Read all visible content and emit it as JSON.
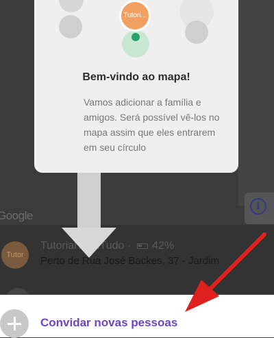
{
  "map": {
    "google_logo": "Google",
    "info_button_glyph": "i"
  },
  "modal": {
    "pin_tutorial_label": "Tutori...",
    "title": "Bem-vindo ao mapa!",
    "body_lines": [
      "Vamos adicionar a família e",
      "amigos. Será possível vê-los no",
      "mapa assim que eles entrarem",
      "em seu círculo"
    ]
  },
  "member": {
    "avatar_text": "Tutor",
    "name": "TutorialTechTudo ·",
    "battery": "42%",
    "address": "Perto de Rua José Backes, 37 - Jardim"
  },
  "footer": {
    "invite_label": "Convidar novas pessoas"
  },
  "colors": {
    "accent": "#6d45c6",
    "arrow": "#e0201c",
    "pin": "#f2a05f"
  }
}
